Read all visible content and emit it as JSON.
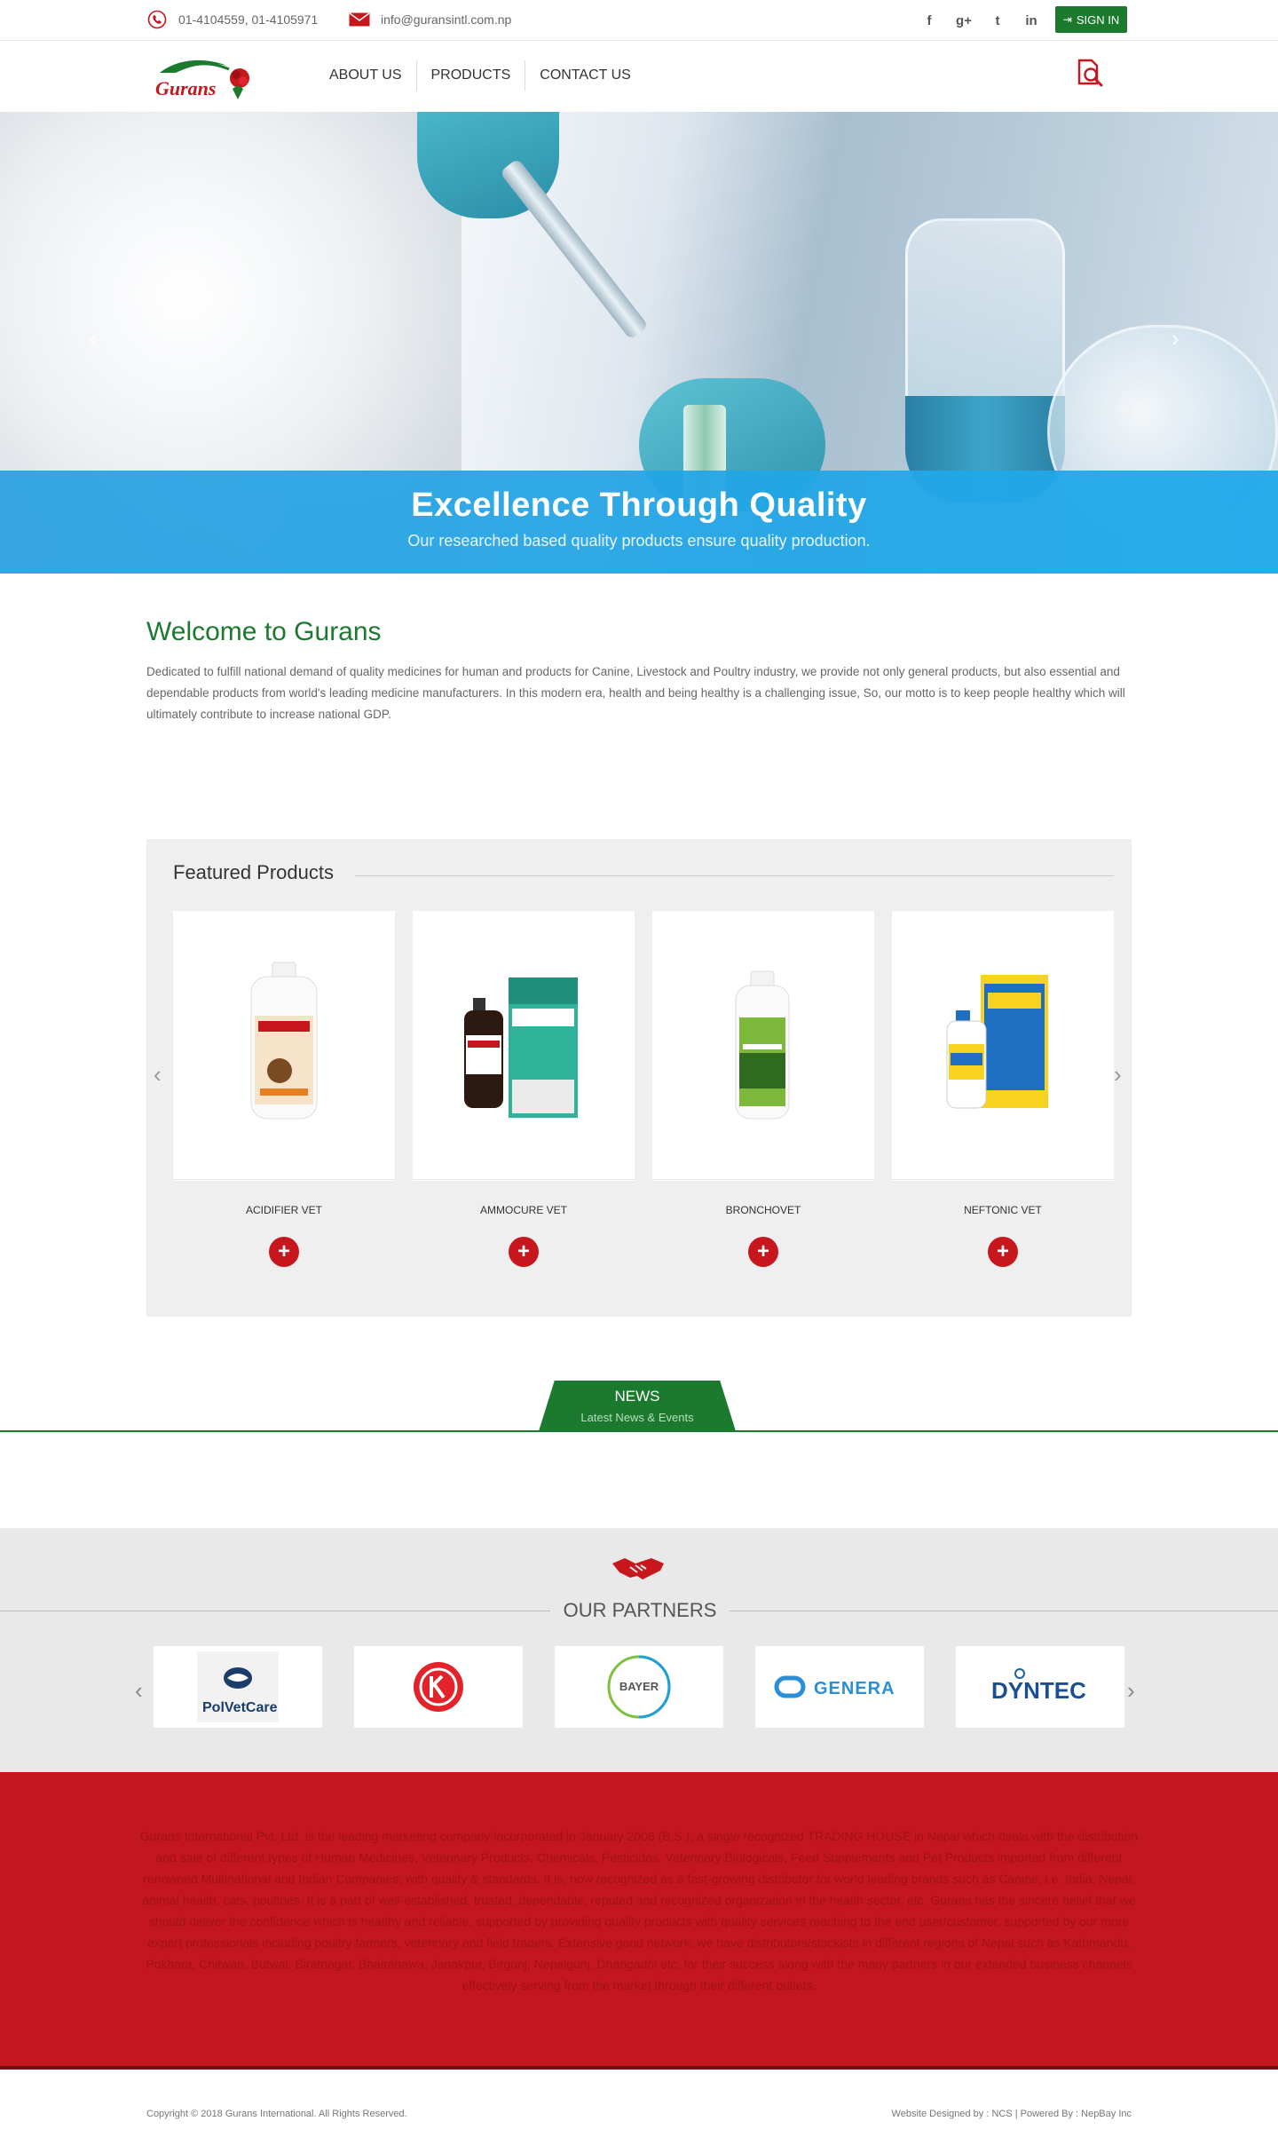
{
  "topbar": {
    "phone": "01-4104559, 01-4105971",
    "email": "info@guransintl.com.np",
    "social": [
      "f",
      "g+",
      "t",
      "in"
    ],
    "signin_label": "SIGN IN"
  },
  "logo": {
    "text": "Gurans"
  },
  "nav": {
    "items": [
      "ABOUT US",
      "PRODUCTS",
      "CONTACT US"
    ]
  },
  "hero": {
    "title": "Excellence Through Quality",
    "subtitle": "Our researched based quality products ensure quality production.",
    "prev": "‹",
    "next": "›"
  },
  "welcome": {
    "title": "Welcome to Gurans",
    "body": "Dedicated to fulfill national demand of quality medicines for human and products for Canine, Livestock and Poultry industry, we provide not only general products, but also essential and dependable products from world's leading medicine manufacturers. In this modern era, health and being healthy is a challenging issue, So, our motto is to keep people healthy which will ultimately contribute to increase national GDP."
  },
  "featured": {
    "title": "Featured Products",
    "products": [
      {
        "name": "ACIDIFIER VET"
      },
      {
        "name": "AMMOCURE VET"
      },
      {
        "name": "BRONCHOVET"
      },
      {
        "name": "NEFTONIC VET"
      }
    ],
    "plus": "+",
    "prev": "‹",
    "next": "›"
  },
  "news": {
    "title": "NEWS",
    "subtitle": "Latest News & Events"
  },
  "partners": {
    "title": "OUR PARTNERS",
    "logos": [
      "PolVetCare",
      "",
      "BAYER",
      "GENERA",
      "DYNTEC"
    ],
    "prev": "‹",
    "next": "›"
  },
  "footer": {
    "about": "Gurans International Pvt. Ltd. is the leading marketing company incorporated in January 2006 (B.S.), a single recognized TRADING HOUSE in Nepal which deals with the distribution and sale of different types of Human Medicines, Veterinary Products, Chemicals, Pesticides, Veterinary Biologicals, Feed Supplements and Pet Products imported from different renowned Multinational and Indian Companies, with quality & standards. It is, now recognized as a fast-growing distributor for world leading brands such as Canine, i.e. India, Nepal, animal health, cats, poultries. It is a part of well-established, trusted, dependable, reputed and recognized organization in the health sector, etc. Gurans has the sincere belief that we should deliver the confidence which is healthy and reliable, supported by providing quality products with quality services reaching to the end user/customer, supported by our more expert professionals including poultry farmers, veterinary and field traders. Extensive good network, we have distributors/stockists in different regions of Nepal such as Kathmandu, Pokhara, Chitwan, Butwal, Biratnagar, Bhairahawa, Janakpur, Birgunj, Nepalgunj, Dhangadhi etc. for their success along with the many partners in our extended business channels effectively serving from the market through their different outlets.",
    "copyright": "Copyright © 2018 Gurans International. All Rights Reserved.",
    "credits": "Website Designed by : NCS | Powered By : NepBay Inc"
  },
  "colors": {
    "brand_green": "#1b7a2d",
    "brand_red": "#c3161e",
    "hero_caption": "#28a0e1"
  }
}
